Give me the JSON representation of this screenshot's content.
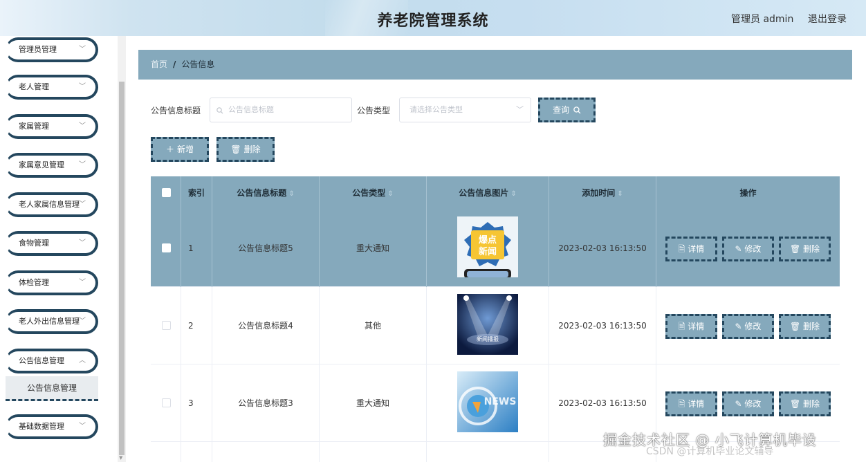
{
  "header": {
    "title": "养老院管理系统",
    "admin": "管理员 admin",
    "logout": "退出登录"
  },
  "sidebar": {
    "items": [
      {
        "label": "管理员管理"
      },
      {
        "label": "老人管理"
      },
      {
        "label": "家属管理"
      },
      {
        "label": "家属意见管理"
      },
      {
        "label": "老人家属信息管理"
      },
      {
        "label": "食物管理"
      },
      {
        "label": "体检管理"
      },
      {
        "label": "老人外出信息管理"
      },
      {
        "label": "公告信息管理"
      },
      {
        "label": "基础数据管理"
      }
    ],
    "sub_item": "公告信息管理"
  },
  "breadcrumb": {
    "home": "首页",
    "sep": "/",
    "current": "公告信息"
  },
  "search": {
    "title_label": "公告信息标题",
    "title_placeholder": "公告信息标题",
    "type_label": "公告类型",
    "type_placeholder": "请选择公告类型",
    "query_button": "查询"
  },
  "toolbar": {
    "add": "新增",
    "delete": "删除"
  },
  "table": {
    "columns": [
      "索引",
      "公告信息标题",
      "公告类型",
      "公告信息图片",
      "添加时间",
      "操作"
    ],
    "rows": [
      {
        "index": "1",
        "title": "公告信息标题5",
        "type": "重大通知",
        "image": "爆点新闻",
        "time": "2023-02-03 16:13:50"
      },
      {
        "index": "2",
        "title": "公告信息标题4",
        "type": "其他",
        "image": "新闻播报",
        "time": "2023-02-03 16:13:50"
      },
      {
        "index": "3",
        "title": "公告信息标题3",
        "type": "重大通知",
        "image": "NEWS",
        "time": "2023-02-03 16:13:50"
      }
    ],
    "actions": {
      "detail": "详情",
      "edit": "修改",
      "delete": "删除"
    }
  },
  "watermark": {
    "main": "掘金技术社区 @ 小飞计算机毕设",
    "sub": "CSDN @计算机毕业论文辅导"
  },
  "colors": {
    "accent": "#85a9bc",
    "border_dark": "#24475e",
    "header_bg": "#c6def0"
  },
  "icons": {
    "search": "search-icon",
    "chevron": "chevron-down-icon",
    "plus": "plus-icon",
    "trash": "trash-icon",
    "doc": "document-icon",
    "pencil": "pencil-icon",
    "sort": "sort-icon"
  }
}
